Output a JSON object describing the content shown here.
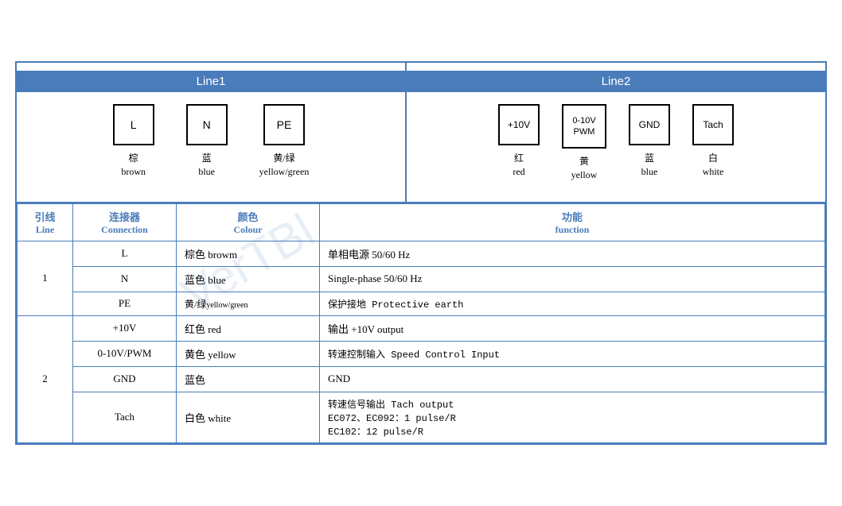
{
  "headers": {
    "line1": "Line1",
    "line2": "Line2"
  },
  "line1": {
    "connectors": [
      {
        "label": "L",
        "color_zh": "棕",
        "color_en": "brown"
      },
      {
        "label": "N",
        "color_zh": "蓝",
        "color_en": "blue"
      },
      {
        "label": "PE",
        "color_zh": "黄/绿",
        "color_en": "yellow/green"
      }
    ]
  },
  "line2": {
    "connectors": [
      {
        "label": "+10V",
        "color_zh": "红",
        "color_en": "red"
      },
      {
        "label": "0-10V\nPWM",
        "color_zh": "黄",
        "color_en": "yellow"
      },
      {
        "label": "GND",
        "color_zh": "蓝",
        "color_en": "blue"
      },
      {
        "label": "Tach",
        "color_zh": "白",
        "color_en": "white"
      }
    ]
  },
  "table": {
    "headers": {
      "line_zh": "引线",
      "line_en": "Line",
      "conn_zh": "连接器",
      "conn_en": "Connection",
      "color_zh": "颜色",
      "color_en": "Colour",
      "func_zh": "功能",
      "func_en": "function"
    },
    "rows": [
      {
        "line": "1",
        "rowspan": 3,
        "entries": [
          {
            "connector": "L",
            "color": "棕色 browm",
            "function": "单相电源 50/60 Hz"
          },
          {
            "connector": "N",
            "color": "蓝色 blue",
            "function": "Single-phase 50/60 Hz"
          },
          {
            "connector": "PE",
            "color": "黄/绿 yellow/green",
            "function": "保护接地 Protective earth"
          }
        ]
      },
      {
        "line": "2",
        "rowspan": 4,
        "entries": [
          {
            "connector": "+10V",
            "color": "红色 red",
            "function": "输出 +10V output"
          },
          {
            "connector": "0-10V/PWM",
            "color": "黄色 yellow",
            "function": "转速控制输入 Speed Control Input"
          },
          {
            "connector": "GND",
            "color": "蓝色",
            "function": "GND"
          },
          {
            "connector": "Tach",
            "color": "白色 white",
            "function": "转速信号输出 Tach output\nEC072、EC092：1 pulse/R\nEC102：12 pulse/R"
          }
        ]
      }
    ]
  }
}
